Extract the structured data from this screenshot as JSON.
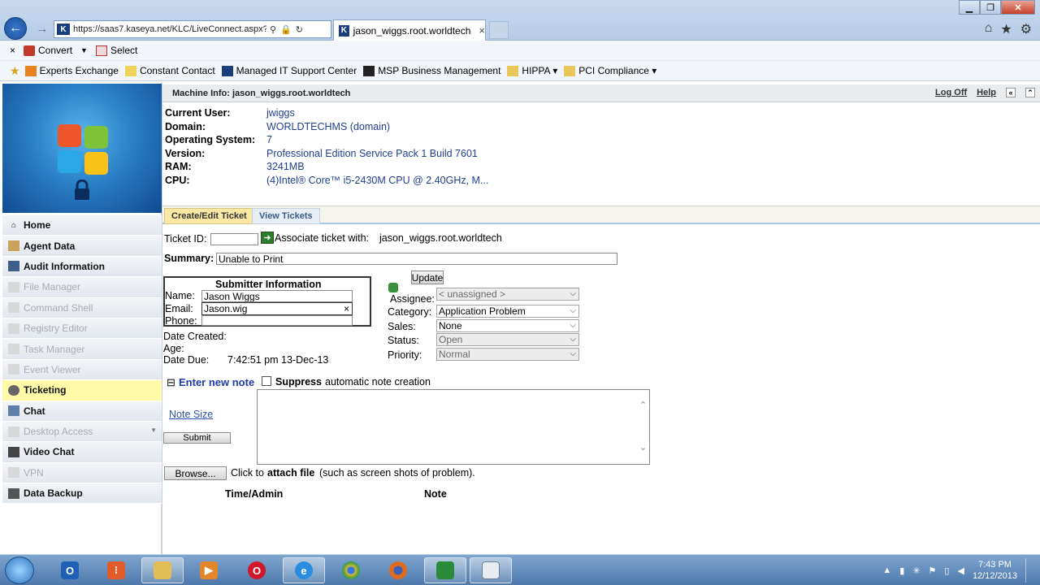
{
  "browser": {
    "address": "https://saas7.kaseya.net/KLC/LiveConnect.aspx?",
    "site_icon": "K",
    "tab_title": "jason_wiggs.root.worldtech",
    "tab_close": "×",
    "command_bar": {
      "close": "×",
      "convert": "Convert",
      "select": "Select"
    },
    "favorites": [
      {
        "label": "Experts Exchange",
        "icon": "ee-icon"
      },
      {
        "label": "Constant Contact",
        "icon": "cc-icon"
      },
      {
        "label": "Managed IT Support Center",
        "icon": "kaseya-icon"
      },
      {
        "label": "MSP Business Management",
        "icon": "msp-icon"
      },
      {
        "label": "HIPPA ▾",
        "icon": "folder-icon"
      },
      {
        "label": "PCI Compliance ▾",
        "icon": "folder-icon"
      }
    ]
  },
  "sidebar": {
    "items": [
      {
        "label": "Home",
        "enabled": true
      },
      {
        "label": "Agent Data",
        "enabled": true
      },
      {
        "label": "Audit Information",
        "enabled": true
      },
      {
        "label": "File Manager",
        "enabled": false
      },
      {
        "label": "Command Shell",
        "enabled": false
      },
      {
        "label": "Registry Editor",
        "enabled": false
      },
      {
        "label": "Task Manager",
        "enabled": false
      },
      {
        "label": "Event Viewer",
        "enabled": false
      },
      {
        "label": "Ticketing",
        "enabled": true,
        "active": true
      },
      {
        "label": "Chat",
        "enabled": true
      },
      {
        "label": "Desktop Access",
        "enabled": false
      },
      {
        "label": "Video Chat",
        "enabled": true
      },
      {
        "label": "VPN",
        "enabled": false
      },
      {
        "label": "Data Backup",
        "enabled": true
      }
    ]
  },
  "machine": {
    "title": "Machine Info: jason_wiggs.root.worldtech",
    "logoff": "Log Off",
    "help": "Help",
    "fields": [
      {
        "key": "Current User:",
        "value": "jwiggs"
      },
      {
        "key": "Domain:",
        "value": "WORLDTECHMS (domain)"
      },
      {
        "key": "Operating System:",
        "value": "7"
      },
      {
        "key": "Version:",
        "value": "Professional Edition Service Pack 1 Build 7601"
      },
      {
        "key": "RAM:",
        "value": "3241MB"
      },
      {
        "key": "CPU:",
        "value": "(4)Intel® Core™ i5-2430M CPU @ 2.40GHz, M..."
      }
    ]
  },
  "tabs": {
    "create": "Create/Edit Ticket",
    "view": "View Tickets"
  },
  "ticket": {
    "ticket_id_label": "Ticket ID:",
    "ticket_id_value": "",
    "associate_label": "Associate ticket with:",
    "associate_value": "jason_wiggs.root.worldtech",
    "summary_label": "Summary:",
    "summary_value": "Unable to Print",
    "submitter_title": "Submitter Information",
    "name_label": "Name:",
    "name_value": "Jason Wiggs",
    "email_label": "Email:",
    "email_value": "Jason.wig",
    "email_clear": "×",
    "phone_label": "Phone:",
    "phone_value": "",
    "date_created_label": "Date Created:",
    "age_label": "Age:",
    "date_due_label": "Date Due:",
    "date_due_value": "7:42:51 pm 13-Dec-13",
    "update_button": "Update",
    "assignee_label": "Assignee:",
    "assignee_value": "< unassigned >",
    "category_label": "Category:",
    "category_value": "Application Problem",
    "sales_label": "Sales:",
    "sales_value": "None",
    "status_label": "Status:",
    "status_value": "Open",
    "priority_label": "Priority:",
    "priority_value": "Normal",
    "enter_note": "Enter new note",
    "enter_note_toggle": "⊟",
    "suppress_bold": "Suppress",
    "suppress_rest": "automatic note creation",
    "note_size": "Note Size",
    "submit": "Submit",
    "browse": "Browse...",
    "attach_pre": "Click to",
    "attach_bold": "attach file",
    "attach_post": "(such as screen shots of problem).",
    "col_time": "Time/Admin",
    "col_note": "Note"
  },
  "taskbar": {
    "apps": [
      "outlook-icon",
      "apps-icon",
      "explorer-icon",
      "media-icon",
      "opera-icon",
      "ie-icon",
      "chrome-icon",
      "firefox-icon",
      "kaseya-live-icon",
      "window-icon"
    ],
    "time": "7:43 PM",
    "date": "12/12/2013"
  }
}
